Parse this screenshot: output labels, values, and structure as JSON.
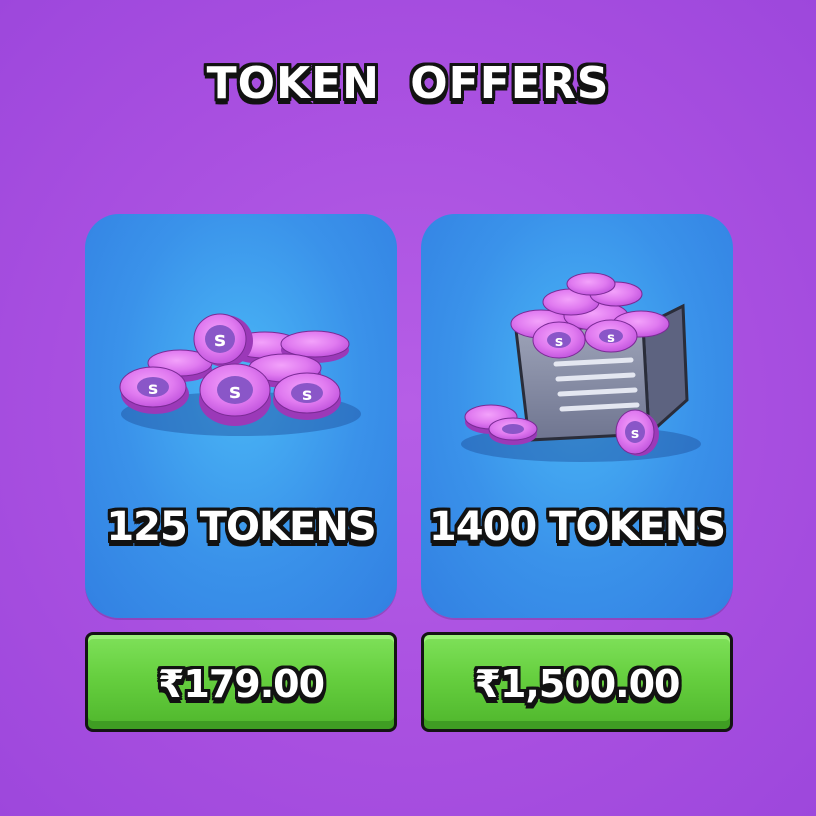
{
  "header": {
    "title": "TOKEN OFFERS"
  },
  "offers": [
    {
      "label": "125 TOKENS",
      "price": "₹179.00",
      "image": "token-pile-icon"
    },
    {
      "label": "1400 TOKENS",
      "price": "₹1,500.00",
      "image": "token-chest-icon"
    }
  ],
  "colors": {
    "background": "#a84fe0",
    "card": "#3a92ea",
    "button": "#66cf3f",
    "token": "#d568ec",
    "outline": "#121212"
  }
}
